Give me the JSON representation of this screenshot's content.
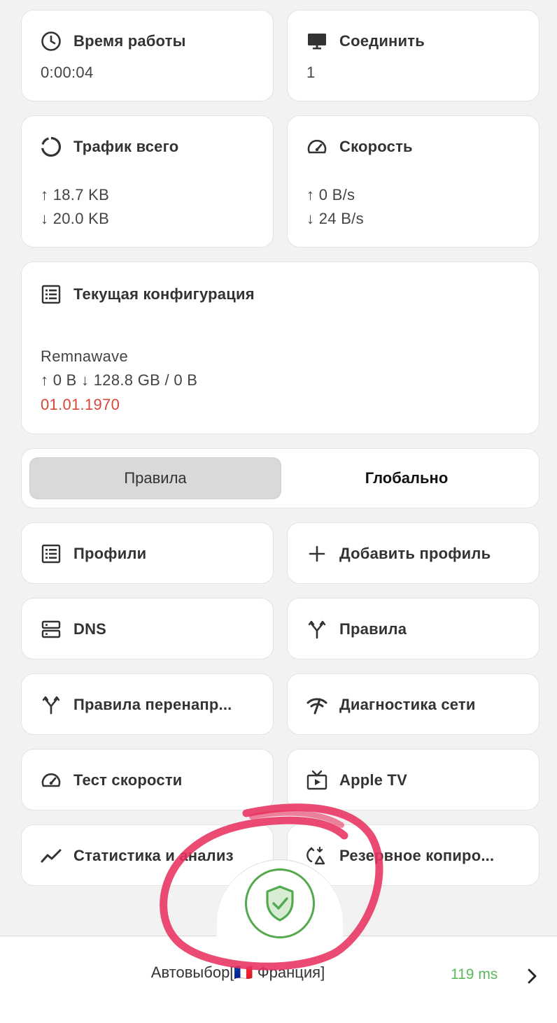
{
  "uptime": {
    "label": "Время работы",
    "value": "0:00:04",
    "icon": "clock-icon"
  },
  "connections": {
    "label": "Соединить",
    "value": "1",
    "icon": "monitor-icon"
  },
  "traffic": {
    "label": "Трафик всего",
    "up": "↑ 18.7 KB",
    "down": "↓ 20.0 KB",
    "icon": "circle-progress-icon"
  },
  "speed": {
    "label": "Скорость",
    "up": "↑ 0 B/s",
    "down": "↓ 24 B/s",
    "icon": "speedometer-icon"
  },
  "config": {
    "label": "Текущая конфигурация",
    "name": "Remnawave",
    "usage": "↑ 0 B ↓ 128.8 GB / 0 B",
    "expiry": "01.01.1970",
    "expiry_color": "#d6473a",
    "icon": "list-icon"
  },
  "mode": {
    "rules_label": "Правила",
    "global_label": "Глобально",
    "selected": "Правила"
  },
  "tiles": [
    {
      "label": "Профили",
      "icon": "list-icon"
    },
    {
      "label": "Добавить профиль",
      "icon": "plus-icon"
    },
    {
      "label": "DNS",
      "icon": "dns-icon"
    },
    {
      "label": "Правила",
      "icon": "fork-icon"
    },
    {
      "label": "Правила перенапр...",
      "icon": "fork-icon"
    },
    {
      "label": "Диагностика сети",
      "icon": "network-diagnostic-icon"
    },
    {
      "label": "Тест скорости",
      "icon": "speedometer-icon"
    },
    {
      "label": "Apple TV",
      "icon": "tv-icon"
    },
    {
      "label": "Статистика и анализ",
      "icon": "chart-line-icon"
    },
    {
      "label": "Резервное копиро...",
      "icon": "backup-icon"
    }
  ],
  "bottom": {
    "server": "Автовыбор[🇫🇷 Франция]",
    "ping": "119 ms",
    "ping_color": "#5cb85c",
    "connect_icon": "shield-check-icon",
    "connect_color": "#53a94e"
  },
  "annotation_color": "#e8325f"
}
